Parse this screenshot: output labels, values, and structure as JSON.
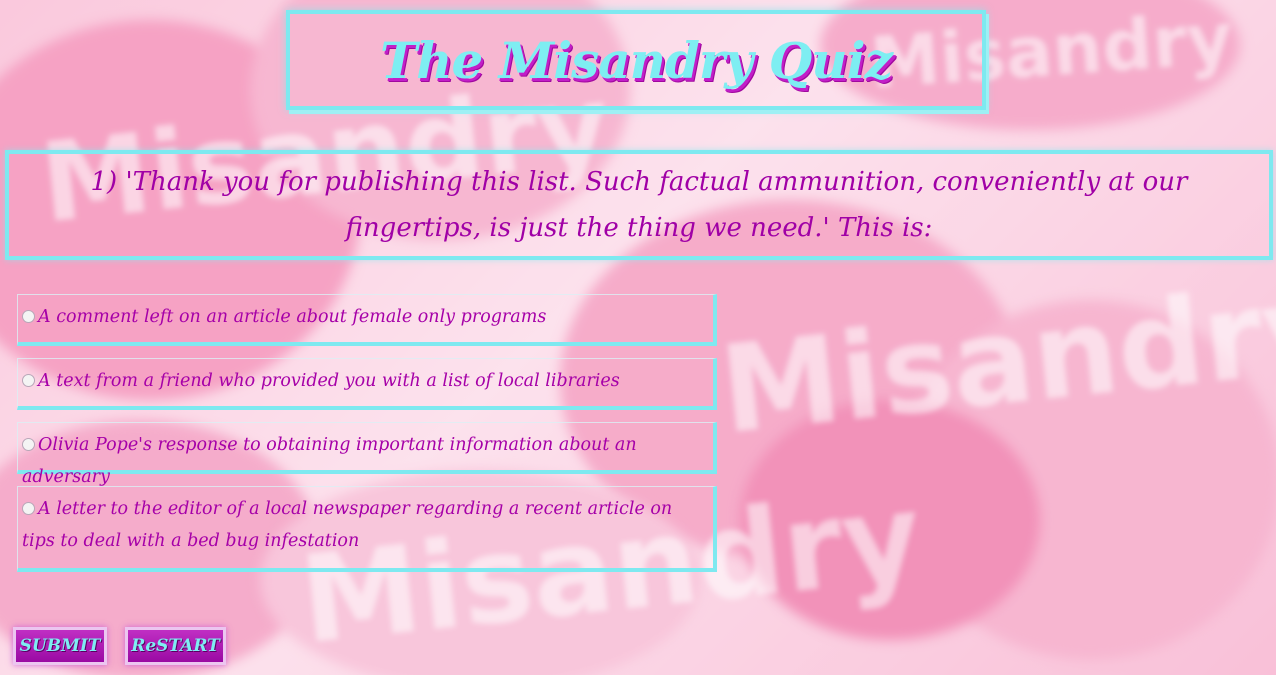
{
  "quiz": {
    "title": "The Misandry Quiz",
    "background_word": "Misandry",
    "question": {
      "text": "1) 'Thank you for publishing this list. Such factual ammunition, conveniently at our fingertips, is just the thing we need.' This is:"
    },
    "answers": [
      {
        "label": "A comment left on an article about female only programs",
        "selected": false
      },
      {
        "label": "A text from a friend who provided you with a list of local libraries",
        "selected": false
      },
      {
        "label": "Olivia Pope's response to obtaining important information about an adversary",
        "selected": false
      },
      {
        "label": "A letter to the editor of a local newspaper regarding a recent article on tips to deal with a bed bug infestation",
        "selected": false
      }
    ],
    "buttons": {
      "submit_label": "SUBMIT",
      "restart_label": "ReSTART"
    }
  },
  "colors": {
    "accent_cyan": "#7ee9f0",
    "text_magenta": "#a000a6",
    "button_purple": "#b01eb8",
    "background_pink": "#f7a8c8"
  }
}
